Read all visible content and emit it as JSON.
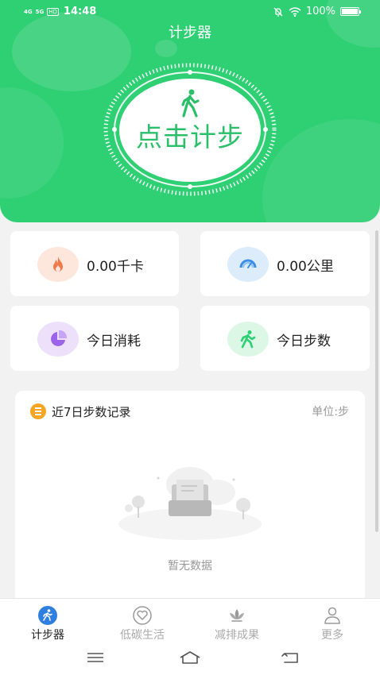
{
  "status_bar": {
    "network1": "4G",
    "network2": "5G",
    "hd": "HD",
    "time": "14:48",
    "battery": "100%"
  },
  "header": {
    "title": "计步器",
    "start_button": "点击计步"
  },
  "stats": [
    {
      "label": "0.00千卡",
      "icon": "fire-icon",
      "bg": "#fde7dc",
      "color": "#f07a4a"
    },
    {
      "label": "0.00公里",
      "icon": "gauge-icon",
      "bg": "#dcecfb",
      "color": "#3a8ee6"
    },
    {
      "label": "今日消耗",
      "icon": "pie-chart-icon",
      "bg": "#ece0fb",
      "color": "#9a63e8"
    },
    {
      "label": "今日步数",
      "icon": "runner-icon",
      "bg": "#dcf7e6",
      "color": "#2fcf74"
    }
  ],
  "records": {
    "title": "近7日步数记录",
    "unit": "单位:步",
    "empty_text": "暂无数据"
  },
  "tabs": [
    {
      "label": "计步器",
      "icon": "runner-icon",
      "active": true
    },
    {
      "label": "低碳生活",
      "icon": "heart-icon",
      "active": false
    },
    {
      "label": "减排成果",
      "icon": "lotus-icon",
      "active": false
    },
    {
      "label": "更多",
      "icon": "person-icon",
      "active": false
    }
  ],
  "colors": {
    "primary": "#2fcf74",
    "accent_orange": "#f5a623"
  }
}
